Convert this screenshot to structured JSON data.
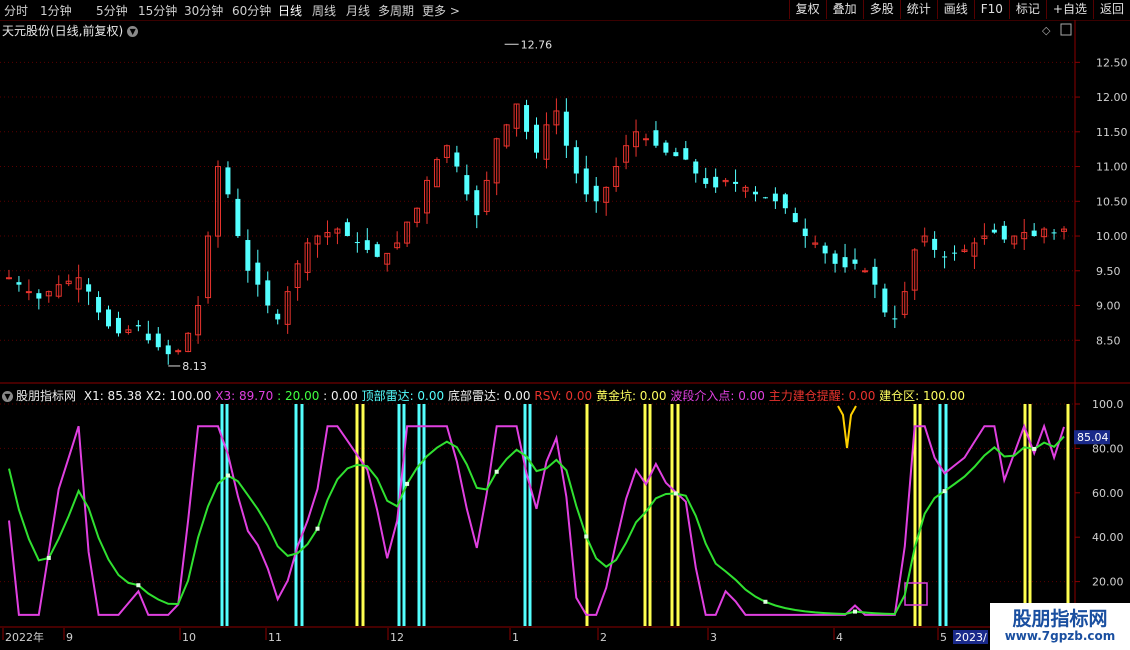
{
  "toolbar": {
    "periods": [
      "分时",
      "1分钟",
      "5分钟",
      "15分钟",
      "30分钟",
      "60分钟",
      "日线",
      "周线",
      "月线",
      "多周期",
      "更多 >"
    ],
    "active_period": "日线",
    "buttons": [
      "复权",
      "叠加",
      "多股",
      "统计",
      "画线",
      "F10",
      "标记",
      "+自选",
      "返回"
    ]
  },
  "main_chart": {
    "title": "天元股份(日线,前复权)",
    "high_label": "12.76",
    "low_label": "8.13",
    "price_axis": [
      "12.50",
      "12.00",
      "11.50",
      "11.00",
      "10.50",
      "10.00",
      "9.50",
      "9.00",
      "8.50"
    ],
    "up_color": "#e8332d",
    "down_color": "#54ffff"
  },
  "indicator": {
    "name": "股朋指标网",
    "fields": [
      {
        "label": "X1: 85.38",
        "color": "#f0f0f0"
      },
      {
        "label": "X2: 100.00",
        "color": "#f0f0f0"
      },
      {
        "label": "X3: 89.70",
        "color": "#e040e0"
      },
      {
        "label": ": 20.00",
        "color": "#40ff40"
      },
      {
        "label": ": 0.00",
        "color": "#f0f0f0"
      },
      {
        "label": "顶部雷达: 0.00",
        "color": "#54ffff"
      },
      {
        "label": "底部雷达: 0.00",
        "color": "#f0f0f0"
      },
      {
        "label": "RSV: 0.00",
        "color": "#e8332d"
      },
      {
        "label": "黄金坑: 0.00",
        "color": "#ffff60"
      },
      {
        "label": "波段介入点: 0.00",
        "color": "#e040e0"
      },
      {
        "label": "主力建仓提醒: 0.00",
        "color": "#e8332d"
      },
      {
        "label": "建仓区: 100.00",
        "color": "#ffff60"
      }
    ],
    "axis": [
      "100.0",
      "80.00",
      "60.00",
      "40.00",
      "20.00"
    ],
    "current_value": "85.04"
  },
  "date_axis": {
    "labels": [
      "2022年",
      "9",
      "10",
      "11",
      "12",
      "1",
      "2",
      "3",
      "4",
      "5"
    ],
    "current_year": "2023/"
  },
  "watermark": {
    "title": "股朋指标网",
    "url": "www.7gpzb.com"
  },
  "chart_data": {
    "type": "candlestick",
    "title": "天元股份(日线,前复权)",
    "price_range": [
      8.13,
      12.76
    ],
    "price_ticks": [
      8.5,
      9.0,
      9.5,
      10.0,
      10.5,
      11.0,
      11.5,
      12.0,
      12.5
    ],
    "close_trace": [
      9.4,
      9.3,
      9.2,
      9.1,
      9.2,
      9.3,
      9.35,
      9.4,
      9.2,
      8.9,
      8.7,
      8.6,
      8.65,
      8.7,
      8.5,
      8.4,
      8.3,
      8.35,
      8.6,
      9.0,
      10.0,
      11.0,
      10.6,
      10.0,
      9.5,
      9.3,
      9.0,
      8.8,
      9.2,
      9.6,
      9.9,
      10.0,
      10.05,
      10.1,
      10.0,
      9.9,
      9.8,
      9.7,
      9.75,
      9.9,
      10.2,
      10.4,
      10.8,
      11.1,
      11.3,
      11.0,
      10.6,
      10.3,
      10.8,
      11.4,
      11.6,
      11.9,
      11.5,
      11.2,
      11.6,
      11.8,
      11.3,
      10.9,
      10.6,
      10.5,
      10.7,
      11.0,
      11.3,
      11.5,
      11.4,
      11.3,
      11.2,
      11.15,
      11.1,
      10.9,
      10.75,
      10.7,
      10.8,
      10.75,
      10.7,
      10.6,
      10.55,
      10.5,
      10.4,
      10.2,
      10.0,
      9.9,
      9.75,
      9.6,
      9.55,
      9.6,
      9.5,
      9.3,
      8.9,
      8.8,
      9.2,
      9.8,
      10.0,
      9.8,
      9.7,
      9.75,
      9.8,
      9.9,
      10.0,
      10.05,
      9.95,
      10.0,
      10.05,
      10.0,
      10.1,
      10.05,
      10.1
    ],
    "indicator": {
      "range": [
        0,
        100
      ],
      "ticks": [
        20,
        40,
        60,
        80,
        100
      ],
      "x1_last": 85.38,
      "x2_last": 100.0,
      "x3_last": 89.7,
      "threshold": 20.0
    }
  }
}
